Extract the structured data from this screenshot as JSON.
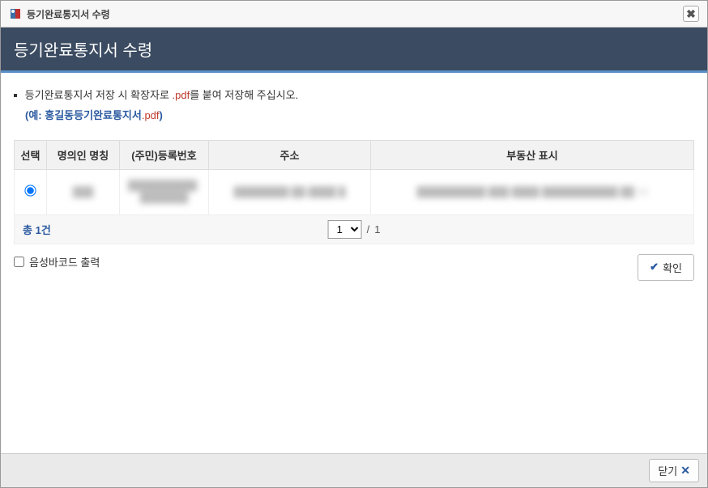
{
  "window": {
    "title": "등기완료통지서 수령"
  },
  "header": {
    "title": "등기완료통지서 수령"
  },
  "notice": {
    "line1_pre": "등기완료통지서 저장 시 확장자로 ",
    "line1_ext": ".pdf",
    "line1_post": "를 붙여 저장해 주십시오.",
    "example_pre": "(예: ",
    "example_name": "홍길동등기완료통지서",
    "example_ext": ".pdf",
    "example_post": ")"
  },
  "table": {
    "headers": {
      "select": "선택",
      "name": "명의인 명칭",
      "regno": "(주민)등록번호",
      "address": "주소",
      "property": "부동산 표시"
    },
    "rows": [
      {
        "name": "███",
        "regno": "██████████-███████",
        "address": "████████ ██-████ █",
        "property": "██████████ ███ ████ ███████████ ██ 13"
      }
    ]
  },
  "pagination": {
    "total_prefix": "총 ",
    "total_count": "1",
    "total_suffix": "건",
    "current_page": "1",
    "total_pages": "1",
    "separator": "/"
  },
  "options": {
    "voice_barcode": "음성바코드 출력"
  },
  "buttons": {
    "confirm": "확인",
    "close": "닫기"
  }
}
